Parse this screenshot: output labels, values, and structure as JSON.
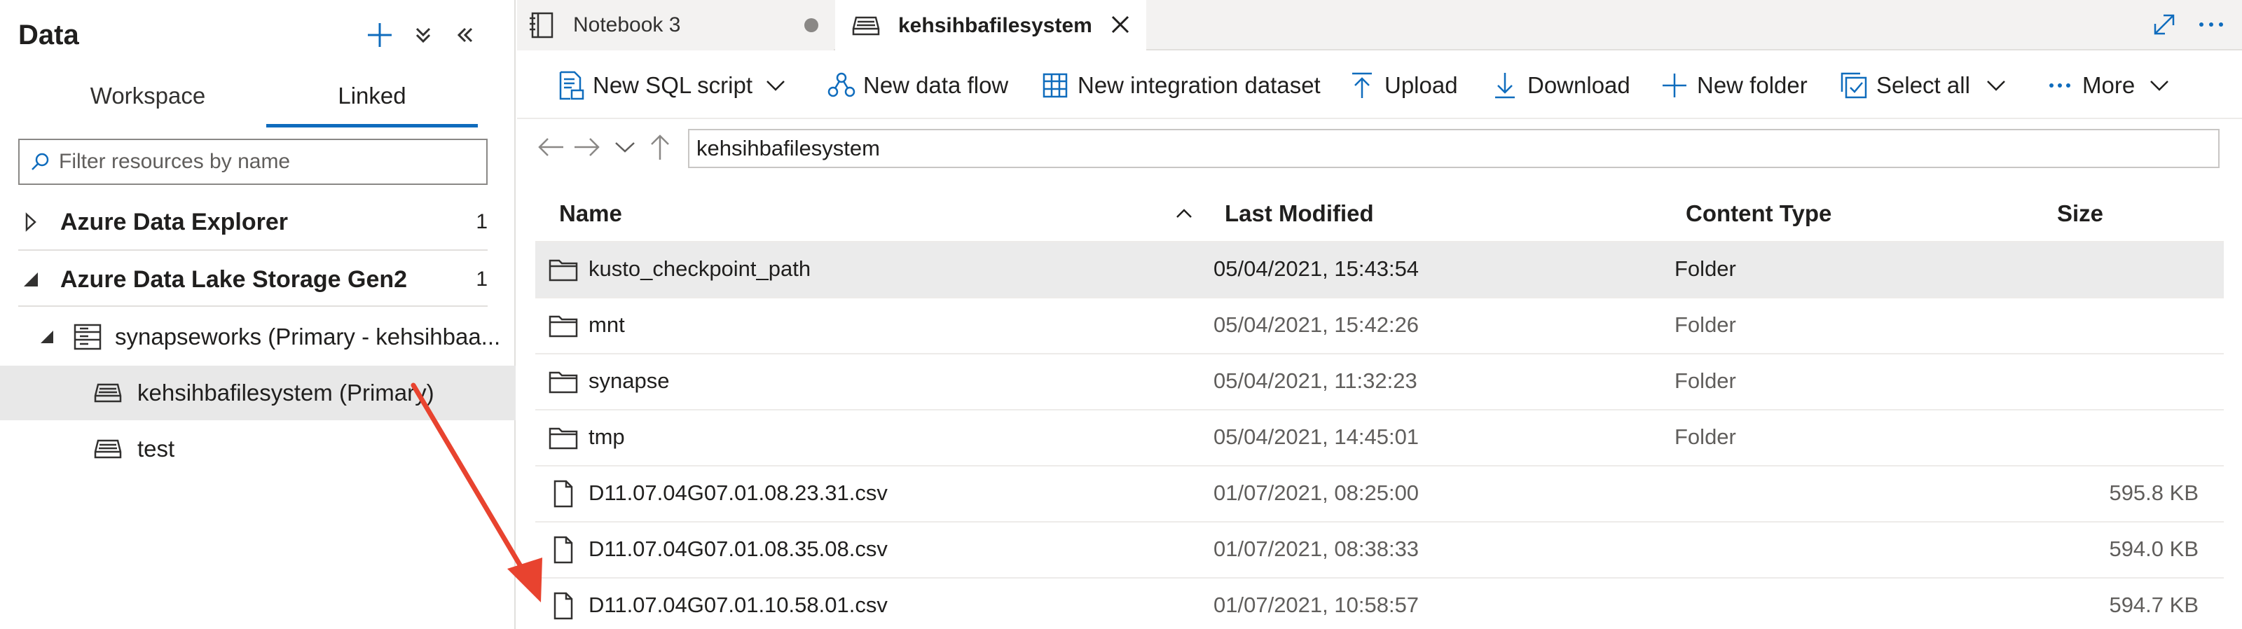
{
  "left_panel": {
    "title": "Data",
    "tabs": [
      {
        "label": "Workspace",
        "active": false
      },
      {
        "label": "Linked",
        "active": true
      }
    ],
    "filter_placeholder": "Filter resources by name",
    "tree": [
      {
        "label": "Azure Data Explorer",
        "count": "1",
        "expanded": false
      },
      {
        "label": "Azure Data Lake Storage Gen2",
        "count": "1",
        "expanded": true
      },
      {
        "label": "synapseworks (Primary - kehsihbaa..."
      },
      {
        "label": "kehsihbafilesystem (Primary)",
        "selected": true
      },
      {
        "label": "test"
      }
    ]
  },
  "doc_tabs": [
    {
      "label": "Notebook 3",
      "unsaved": true,
      "active": false
    },
    {
      "label": "kehsihbafilesystem",
      "active": true
    }
  ],
  "toolbar": {
    "new_sql_script": "New SQL script",
    "new_data_flow": "New data flow",
    "new_integration_dataset": "New integration dataset",
    "upload": "Upload",
    "download": "Download",
    "new_folder": "New folder",
    "select_all": "Select all",
    "more": "More"
  },
  "path": "kehsihbafilesystem",
  "grid": {
    "columns": [
      "Name",
      "Last Modified",
      "Content Type",
      "Size"
    ],
    "rows": [
      {
        "name": "kusto_checkpoint_path",
        "modified": "05/04/2021, 15:43:54",
        "type": "Folder",
        "size": "",
        "kind": "folder"
      },
      {
        "name": "mnt",
        "modified": "05/04/2021, 15:42:26",
        "type": "Folder",
        "size": "",
        "kind": "folder"
      },
      {
        "name": "synapse",
        "modified": "05/04/2021, 11:32:23",
        "type": "Folder",
        "size": "",
        "kind": "folder"
      },
      {
        "name": "tmp",
        "modified": "05/04/2021, 14:45:01",
        "type": "Folder",
        "size": "",
        "kind": "folder"
      },
      {
        "name": "D11.07.04G07.01.08.23.31.csv",
        "modified": "01/07/2021, 08:25:00",
        "type": "",
        "size": "595.8 KB",
        "kind": "file"
      },
      {
        "name": "D11.07.04G07.01.08.35.08.csv",
        "modified": "01/07/2021, 08:38:33",
        "type": "",
        "size": "594.0 KB",
        "kind": "file"
      },
      {
        "name": "D11.07.04G07.01.10.58.01.csv",
        "modified": "01/07/2021, 10:58:57",
        "type": "",
        "size": "594.7 KB",
        "kind": "file"
      }
    ]
  },
  "colors": {
    "accent": "#0f6cbd",
    "annotation_arrow": "#e8432f"
  }
}
